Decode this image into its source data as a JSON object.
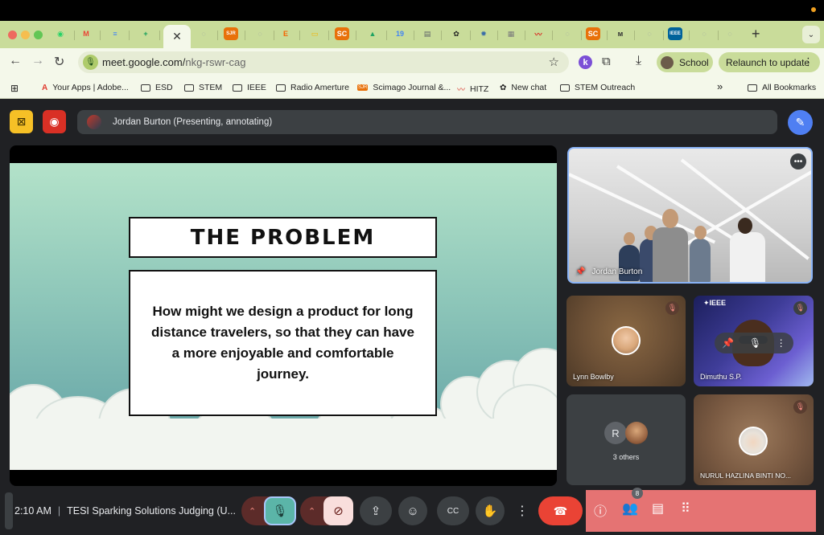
{
  "browser": {
    "url_host": "meet.google.com/",
    "url_path": "nkg-rswr-cag",
    "profile_label": "School",
    "relaunch_label": "Relaunch to update",
    "tab_icons": [
      {
        "name": "whatsapp-tab-icon",
        "glyph": "◉",
        "color": "#25d366"
      },
      {
        "name": "gmail-tab-icon",
        "glyph": "M",
        "color": "#ea4335"
      },
      {
        "name": "docs-tab-icon",
        "glyph": "≡",
        "color": "#4285f4"
      },
      {
        "name": "sheets-tab-icon",
        "glyph": "+",
        "color": "#0f9d58"
      },
      {
        "name": "generic-tab-icon",
        "glyph": "◌",
        "color": "#9aa0a6"
      },
      {
        "name": "sjr-tab-icon",
        "glyph": "SJR",
        "color": "#e8710a"
      },
      {
        "name": "generic-tab-icon",
        "glyph": "◌",
        "color": "#9aa0a6"
      },
      {
        "name": "etsy-tab-icon",
        "glyph": "E",
        "color": "#f56400"
      },
      {
        "name": "slides-tab-icon",
        "glyph": "▭",
        "color": "#f4b400"
      },
      {
        "name": "sc-tab-icon",
        "glyph": "SC",
        "color": "#e8710a"
      },
      {
        "name": "drive-tab-icon",
        "glyph": "▲",
        "color": "#1ea362"
      },
      {
        "name": "calendar-tab-icon",
        "glyph": "19",
        "color": "#4285f4"
      },
      {
        "name": "doc-tab-icon",
        "glyph": "▤",
        "color": "#5f6368"
      },
      {
        "name": "openai-tab-icon",
        "glyph": "✿",
        "color": "#222222"
      },
      {
        "name": "gear-tab-icon",
        "glyph": "✹",
        "color": "#3b6ea8"
      },
      {
        "name": "image-tab-icon",
        "glyph": "▦",
        "color": "#7a7a7a"
      },
      {
        "name": "hitz-tab-icon",
        "glyph": "〰",
        "color": "#d93025"
      },
      {
        "name": "generic-tab-icon",
        "glyph": "◌",
        "color": "#9aa0a6"
      },
      {
        "name": "sc-tab-icon",
        "glyph": "SC",
        "color": "#e8710a"
      },
      {
        "name": "m-tab-icon",
        "glyph": "ᴍ",
        "color": "#333333"
      },
      {
        "name": "generic-tab-icon",
        "glyph": "◌",
        "color": "#9aa0a6"
      },
      {
        "name": "ieee-tab-icon",
        "glyph": "IEEE",
        "color": "#00629b"
      },
      {
        "name": "generic-tab-icon",
        "glyph": "◌",
        "color": "#9aa0a6"
      },
      {
        "name": "generic-tab-icon",
        "glyph": "◌",
        "color": "#9aa0a6"
      }
    ],
    "bookmarks": [
      {
        "label": "",
        "icon": "apps-grid-icon"
      },
      {
        "label": "Your Apps | Adobe...",
        "icon": "adobe-icon"
      },
      {
        "label": "ESD",
        "icon": "folder-icon"
      },
      {
        "label": "STEM",
        "icon": "folder-icon"
      },
      {
        "label": "IEEE",
        "icon": "folder-icon"
      },
      {
        "label": "Radio Amerture",
        "icon": "folder-icon"
      },
      {
        "label": "Scimago Journal &...",
        "icon": "sjr-icon"
      },
      {
        "label": "HITZ",
        "icon": "hitz-icon"
      },
      {
        "label": "New chat",
        "icon": "openai-icon"
      },
      {
        "label": "STEM Outreach",
        "icon": "folder-icon"
      }
    ],
    "bookmarks_overflow": "»",
    "all_bookmarks_label": "All Bookmarks"
  },
  "meet": {
    "presenting_text": "Jordan Burton (Presenting, annotating)",
    "slide": {
      "title": "THE PROBLEM",
      "question": "How might we design a product for long distance travelers, so that they can have a more enjoyable and comfortable journey."
    },
    "participants": {
      "main": "Jordan Burton",
      "lynn": "Lynn Bowlby",
      "dimuthu": "Dimuthu S.P.",
      "ieee_label": "✦IEEE",
      "others_initial": "R",
      "others_label": "3 others",
      "nurul": "NURUL HAZLINA BINTI NO..."
    },
    "bottom": {
      "time": "2:10 AM",
      "meeting_title": "TESI Sparking Solutions Judging (U...",
      "people_count": "8"
    }
  }
}
